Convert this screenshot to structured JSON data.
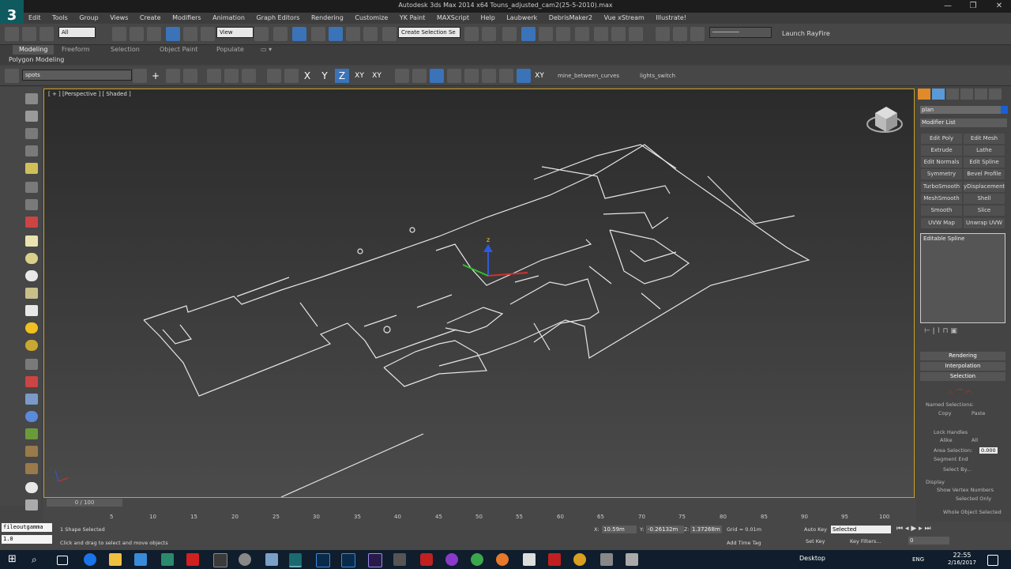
{
  "app": {
    "title": "Autodesk 3ds Max  2014 x64     Touns_adjusted_cam2(25-5-2010).max",
    "logo_letter": "3"
  },
  "window_controls": {
    "minimize": "—",
    "restore": "❐",
    "close": "✕"
  },
  "menu": [
    "Edit",
    "Tools",
    "Group",
    "Views",
    "Create",
    "Modifiers",
    "Animation",
    "Graph Editors",
    "Rendering",
    "Customize",
    "YK Paint",
    "MAXScript",
    "Help",
    "Laubwerk",
    "DebrisMaker2",
    "Vue xStream",
    "Illustrate!"
  ],
  "toolbar": {
    "selection_filter": "All",
    "ref_coord": "View",
    "named_selection": "Create Selection Se",
    "launch_rayfire": "Launch RayFire"
  },
  "ribbon": {
    "tabs": [
      "Modeling",
      "Freeform",
      "Selection",
      "Object Paint",
      "Populate"
    ],
    "active_tab": "Modeling",
    "panel_label": "Polygon Modeling"
  },
  "toolbar2": {
    "layer_name": "spots",
    "axis_labels": [
      "X",
      "Y",
      "Z",
      "XY",
      "XY"
    ],
    "script_btn1": "mine_between_curves",
    "script_btn2": "lights_switch"
  },
  "viewport": {
    "label": "[ + ] [Perspective ] [ Shaded ]",
    "gizmo_axis_z": "z"
  },
  "command_panel": {
    "object_name": "plan",
    "object_color": "#1a5fd6",
    "modifier_list": "Modifier List",
    "modifier_buttons": [
      [
        "Edit Poly",
        "Edit Mesh"
      ],
      [
        "Extrude",
        "Lathe"
      ],
      [
        "Edit Normals",
        "Edit Spline"
      ],
      [
        "Symmetry",
        "Bevel Profile"
      ],
      [
        "TurboSmooth",
        "yDisplacementM"
      ],
      [
        "MeshSmooth",
        "Shell"
      ],
      [
        "Smooth",
        "Slice"
      ],
      [
        "UVW Map",
        "Unwrap UVW"
      ]
    ],
    "stack_item": "Editable Spline",
    "rollouts": [
      "Rendering",
      "Interpolation",
      "Selection"
    ],
    "named_selections": "Named Selections:",
    "copy": "Copy",
    "paste": "Paste",
    "lock_handles": "Lock Handles",
    "alike": "Alike",
    "all": "All",
    "area_selection": "Area Selection:",
    "area_value": "0.000",
    "segment_end": "Segment End",
    "select_by": "Select By...",
    "display": "Display",
    "show_vertex_numbers": "Show Vertex Numbers",
    "selected_only": "Selected Only",
    "whole_object_selected": "Whole Object Selected"
  },
  "timeline": {
    "slider": "0 / 100",
    "ticks": [
      "5",
      "10",
      "15",
      "20",
      "25",
      "30",
      "35",
      "40",
      "45",
      "50",
      "55",
      "60",
      "65",
      "70",
      "75",
      "80",
      "85",
      "90",
      "95",
      "100"
    ]
  },
  "status": {
    "maxscript_line1": "fileoutgamma",
    "maxscript_line2": "1.0",
    "shape_selected": "1 Shape Selected",
    "prompt": "Click and drag to select and move objects",
    "x_label": "X:",
    "x_value": "10.59m",
    "y_label": "Y:",
    "y_value": "-0.26132m",
    "z_label": "Z:",
    "z_value": "1.37268m",
    "grid": "Grid = 0.01m",
    "add_time_tag": "Add Time Tag",
    "auto_key": "Auto Key",
    "set_key": "Set Key",
    "key_mode": "Selected",
    "key_filters": "Key Filters...",
    "frame": "0"
  },
  "taskbar": {
    "desktop": "Desktop",
    "lang": "ENG",
    "time": "22:55",
    "date": "2/16/2017"
  }
}
